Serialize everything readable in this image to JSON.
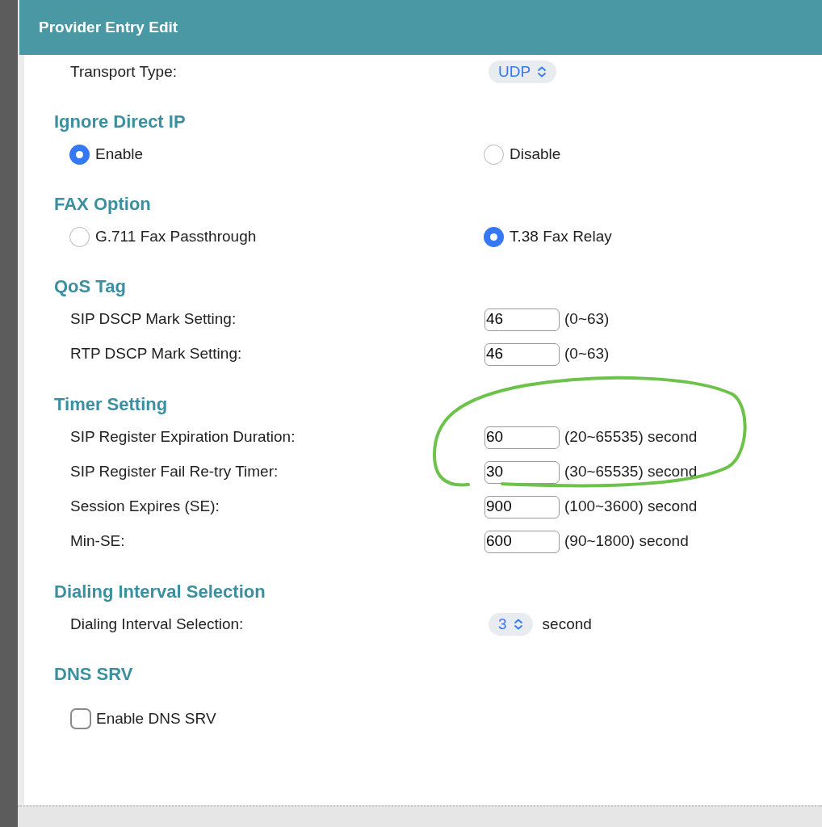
{
  "window": {
    "title": "Provider Entry Edit"
  },
  "sections": [
    {
      "rows": [
        {
          "kind": "select",
          "label": "Transport Type:",
          "value": "UDP"
        }
      ]
    },
    {
      "title": "Ignore Direct IP",
      "rows": [
        {
          "kind": "radio",
          "options": [
            {
              "label": "Enable",
              "selected": true
            },
            {
              "label": "Disable",
              "selected": false
            }
          ]
        }
      ]
    },
    {
      "title": "FAX Option",
      "rows": [
        {
          "kind": "radio",
          "options": [
            {
              "label": "G.711 Fax Passthrough",
              "selected": false
            },
            {
              "label": "T.38 Fax Relay",
              "selected": true
            }
          ]
        }
      ]
    },
    {
      "title": "QoS Tag",
      "rows": [
        {
          "kind": "input",
          "label": "SIP DSCP Mark Setting:",
          "value": "46",
          "hint": "(0~63)"
        },
        {
          "kind": "input",
          "label": "RTP DSCP Mark Setting:",
          "value": "46",
          "hint": "(0~63)"
        }
      ]
    },
    {
      "title": "Timer Setting",
      "rows": [
        {
          "kind": "input",
          "label": "SIP Register Expiration Duration:",
          "value": "60",
          "hint": "(20~65535) second"
        },
        {
          "kind": "input",
          "label": "SIP Register Fail Re-try Timer:",
          "value": "30",
          "hint": "(30~65535) second"
        },
        {
          "kind": "input",
          "label": "Session Expires (SE):",
          "value": "900",
          "hint": "(100~3600) second"
        },
        {
          "kind": "input",
          "label": "Min-SE:",
          "value": "600",
          "hint": "(90~1800) second"
        }
      ]
    },
    {
      "title": "Dialing Interval Selection",
      "rows": [
        {
          "kind": "select",
          "label": "Dialing Interval Selection:",
          "value": "3",
          "hint": "second"
        }
      ]
    },
    {
      "title": "DNS SRV",
      "rows": [
        {
          "kind": "checkbox",
          "label": "Enable DNS SRV",
          "checked": false
        }
      ]
    }
  ]
}
